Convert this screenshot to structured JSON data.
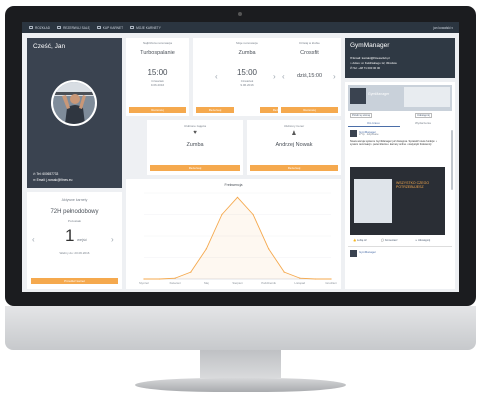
{
  "topnav": {
    "items": [
      {
        "label": "ROZKŁAD",
        "icon": "calendar-icon"
      },
      {
        "label": "REZERWUJ SALĘ",
        "icon": "calendar-icon"
      },
      {
        "label": "KUP KARNET",
        "icon": "card-icon"
      },
      {
        "label": "MOJE KARNETY",
        "icon": "card-icon"
      }
    ],
    "user": "jan kowalski ▾"
  },
  "profile": {
    "greeting": "Cześć, Jan",
    "phone_label": "Tel:",
    "phone": "600657733",
    "email_label": "Email:",
    "email": "j.nowak@fitnes.eu"
  },
  "pass": {
    "title": "Aktywne karnety",
    "name": "72H pełnodobowy",
    "remaining_label": "Pozostało",
    "count": "1",
    "unit": "wejść",
    "valid_until": "Ważny do: 20.06.2016",
    "button": "Przedłuż karnet"
  },
  "next_booking": {
    "title": "Najbliższa rezerwacja",
    "activity": "Turbospalanie",
    "time": "15:00",
    "day": "Czwartek",
    "date": "9.06.2016",
    "button": "Rezerwuj"
  },
  "my_bookings": {
    "title": "Moje rezerwacje",
    "activity": "Zumba",
    "time": "15:00",
    "day": "Czwartek",
    "date": "9.06.2016",
    "button": "Rezerwuj"
  },
  "today": {
    "title": "Dzisiaj w klubie",
    "activity": "Crossfit",
    "time": "dziś,15:00",
    "button": "Rezerwuj"
  },
  "fav_class": {
    "title": "Ulubione zajęcia",
    "name": "Zumba",
    "button": "Rezerwuj",
    "icon": "heart-icon"
  },
  "fav_trainer": {
    "title": "Ulubiony trener",
    "name": "Andrzej Nowak",
    "button": "Rezerwuj",
    "icon": "person-icon"
  },
  "chart": {
    "title": "Frekwencja",
    "xticks": [
      "Styczeń",
      "Kwiecień",
      "Maj",
      "Sierpień",
      "Październik",
      "Listopad",
      "Grudzień"
    ],
    "yticks": [
      "100",
      "75",
      "50",
      "25",
      "0"
    ]
  },
  "chart_data": {
    "type": "line",
    "title": "Frekwencja",
    "categories": [
      "Styczeń",
      "Kwiecień",
      "Maj",
      "Sierpień",
      "Październik",
      "Listopad",
      "Grudzień"
    ],
    "x": [
      0,
      0.5,
      1,
      1.5,
      2,
      2.5,
      3,
      3.5,
      4,
      4.5,
      5,
      5.5,
      6
    ],
    "values": [
      0,
      0,
      1,
      8,
      35,
      75,
      95,
      75,
      35,
      8,
      1,
      0,
      0
    ],
    "ylim": [
      0,
      100
    ],
    "color": "#f5a94e"
  },
  "club": {
    "name": "GymManager",
    "email_label": "Email:",
    "email": "kontakt@fitnessclub.pl",
    "address_label": "Adres:",
    "address": "ul. Kuklińskiego 12, Wrocław",
    "phone_label": "Tel:",
    "phone": "+48 71 000 00 00"
  },
  "facebook": {
    "page_name": "GymManager",
    "likes": "Polub tę stronę",
    "share": "Udostępnij",
    "tab1": "Oś czasu",
    "tab2": "Wydarzenia",
    "post_author": "GymManager",
    "post_time": "27 lip. · Edytowane",
    "post_text": "Nowa wersja systemu GymManager już dostępna. Sprawdź nowe funkcje: • system rezerwacji • panel klienta • karnety online • statystyki frekwencji",
    "banner_text": "WSZYSTKO CZEGO POTRZEBUJESZ",
    "like_label": "Lubię to!",
    "comment_label": "Komentarz",
    "share_label": "Udostępnij",
    "post2_author": "GymManager"
  }
}
